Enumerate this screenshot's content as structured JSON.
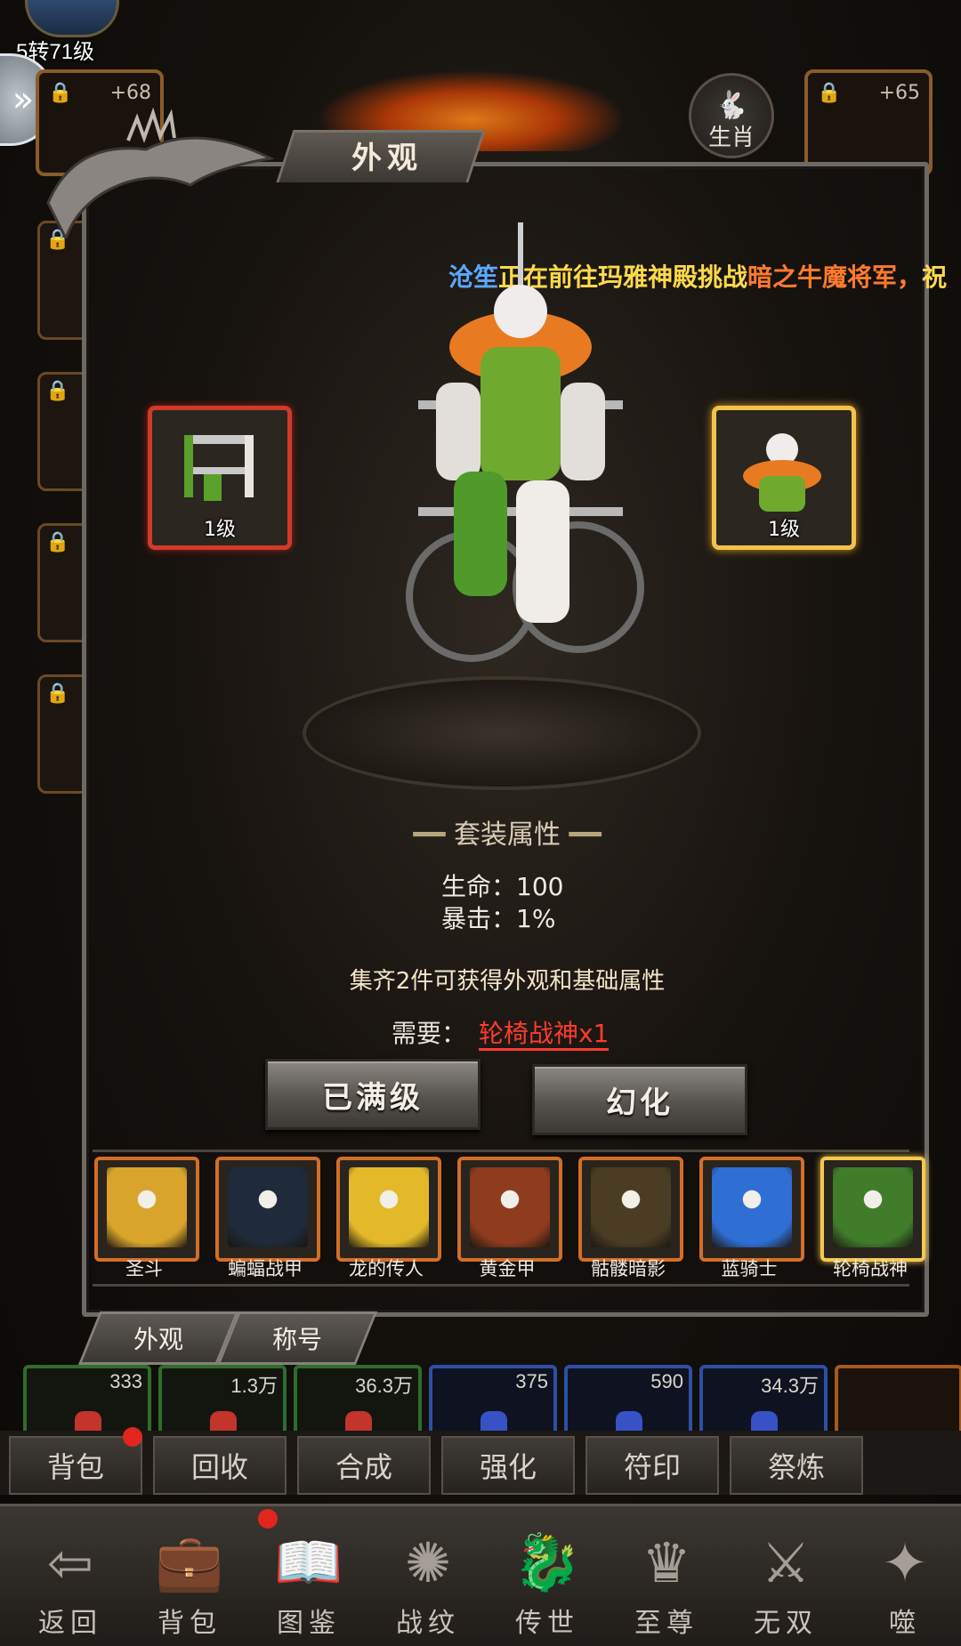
{
  "player": {
    "level_text": "5转71级"
  },
  "header": {
    "top_slot_left_bonus": "+68",
    "top_slot_right_bonus": "+65",
    "zodiac_label": "生肖"
  },
  "panel": {
    "tab_title": "外观",
    "scroll_notice": {
      "player_name": "沧笙",
      "middle": "正在前往玛雅神殿挑战",
      "target": "暗之牛魔将军，",
      "tail": "祝"
    },
    "left_slot_level": "1级",
    "right_slot_level": "1级",
    "set_title": "套装属性",
    "stats": [
      {
        "label": "生命：100"
      },
      {
        "label": "暴击：1%"
      }
    ],
    "collect_text": "集齐2件可获得外观和基础属性",
    "need_label": "需要：",
    "need_item": "轮椅战神x1",
    "max_level_button": "已满级",
    "transform_button": "幻化",
    "skins": [
      {
        "name": "圣斗",
        "color": "#d8a42c"
      },
      {
        "name": "蝙蝠战甲",
        "color": "#1f2b3a"
      },
      {
        "name": "龙的传人",
        "color": "#e3b92a"
      },
      {
        "name": "黄金甲",
        "color": "#8e3b1e"
      },
      {
        "name": "骷髅暗影",
        "color": "#4a3d24"
      },
      {
        "name": "蓝骑士",
        "color": "#2f6fd4"
      },
      {
        "name": "轮椅战神",
        "color": "#3f7d2a"
      }
    ],
    "bottom_tabs": [
      "外观",
      "称号"
    ]
  },
  "potions": [
    {
      "count": "333",
      "color": "#c3342a"
    },
    {
      "count": "1.3万",
      "color": "#c3342a"
    },
    {
      "count": "36.3万",
      "color": "#c3342a"
    },
    {
      "count": "375",
      "color": "#3652c4"
    },
    {
      "count": "590",
      "color": "#3652c4"
    },
    {
      "count": "34.3万",
      "color": "#3652c4"
    }
  ],
  "actions": [
    "背包",
    "回收",
    "合成",
    "强化",
    "符印",
    "祭炼"
  ],
  "nav": [
    {
      "label": "返回",
      "icon": "back-arrow-icon"
    },
    {
      "label": "背包",
      "icon": "backpack-icon"
    },
    {
      "label": "图鉴",
      "icon": "codex-icon"
    },
    {
      "label": "战纹",
      "icon": "war-seal-icon"
    },
    {
      "label": "传世",
      "icon": "dragon-icon"
    },
    {
      "label": "至尊",
      "icon": "crown-helmet-icon"
    },
    {
      "label": "无双",
      "icon": "warrior-icon"
    },
    {
      "label": "噬",
      "icon": "devour-icon"
    }
  ]
}
